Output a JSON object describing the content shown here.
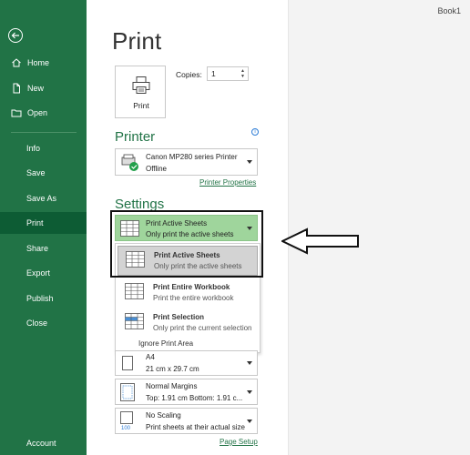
{
  "document": {
    "title": "Book1"
  },
  "sidebar": {
    "back_label": "Back",
    "items": [
      {
        "label": "Home",
        "icon": "home-icon"
      },
      {
        "label": "New",
        "icon": "new-document-icon"
      },
      {
        "label": "Open",
        "icon": "open-folder-icon"
      },
      {
        "label": "Info"
      },
      {
        "label": "Save"
      },
      {
        "label": "Save As"
      },
      {
        "label": "Print",
        "active": true
      },
      {
        "label": "Share"
      },
      {
        "label": "Export"
      },
      {
        "label": "Publish"
      },
      {
        "label": "Close"
      },
      {
        "label": "Account"
      }
    ]
  },
  "page": {
    "title": "Print"
  },
  "print_button": {
    "label": "Print"
  },
  "copies": {
    "label": "Copies:",
    "value": "1"
  },
  "printer": {
    "heading": "Printer",
    "name": "Canon MP280 series Printer",
    "status": "Offline",
    "properties_link": "Printer Properties"
  },
  "settings": {
    "heading": "Settings",
    "what_to_print": {
      "title": "Print Active Sheets",
      "subtitle": "Only print the active sheets"
    },
    "menu": {
      "items": [
        {
          "title": "Print Active Sheets",
          "subtitle": "Only print the active sheets",
          "selected": true
        },
        {
          "title": "Print Entire Workbook",
          "subtitle": "Print the entire workbook"
        },
        {
          "title": "Print Selection",
          "subtitle": "Only print the current selection"
        }
      ],
      "ignore_print_area": "Ignore Print Area"
    },
    "paper": {
      "title": "A4",
      "subtitle": "21 cm x 29.7 cm"
    },
    "margins": {
      "title": "Normal Margins",
      "subtitle": "Top: 1.91 cm Bottom: 1.91 c..."
    },
    "scaling": {
      "title": "No Scaling",
      "subtitle": "Print sheets at their actual size",
      "icon_text": "100"
    },
    "page_setup_link": "Page Setup"
  },
  "colors": {
    "accent": "#217346",
    "active_option": "#9fd59c",
    "sidebar_active": "#0d5c34"
  }
}
